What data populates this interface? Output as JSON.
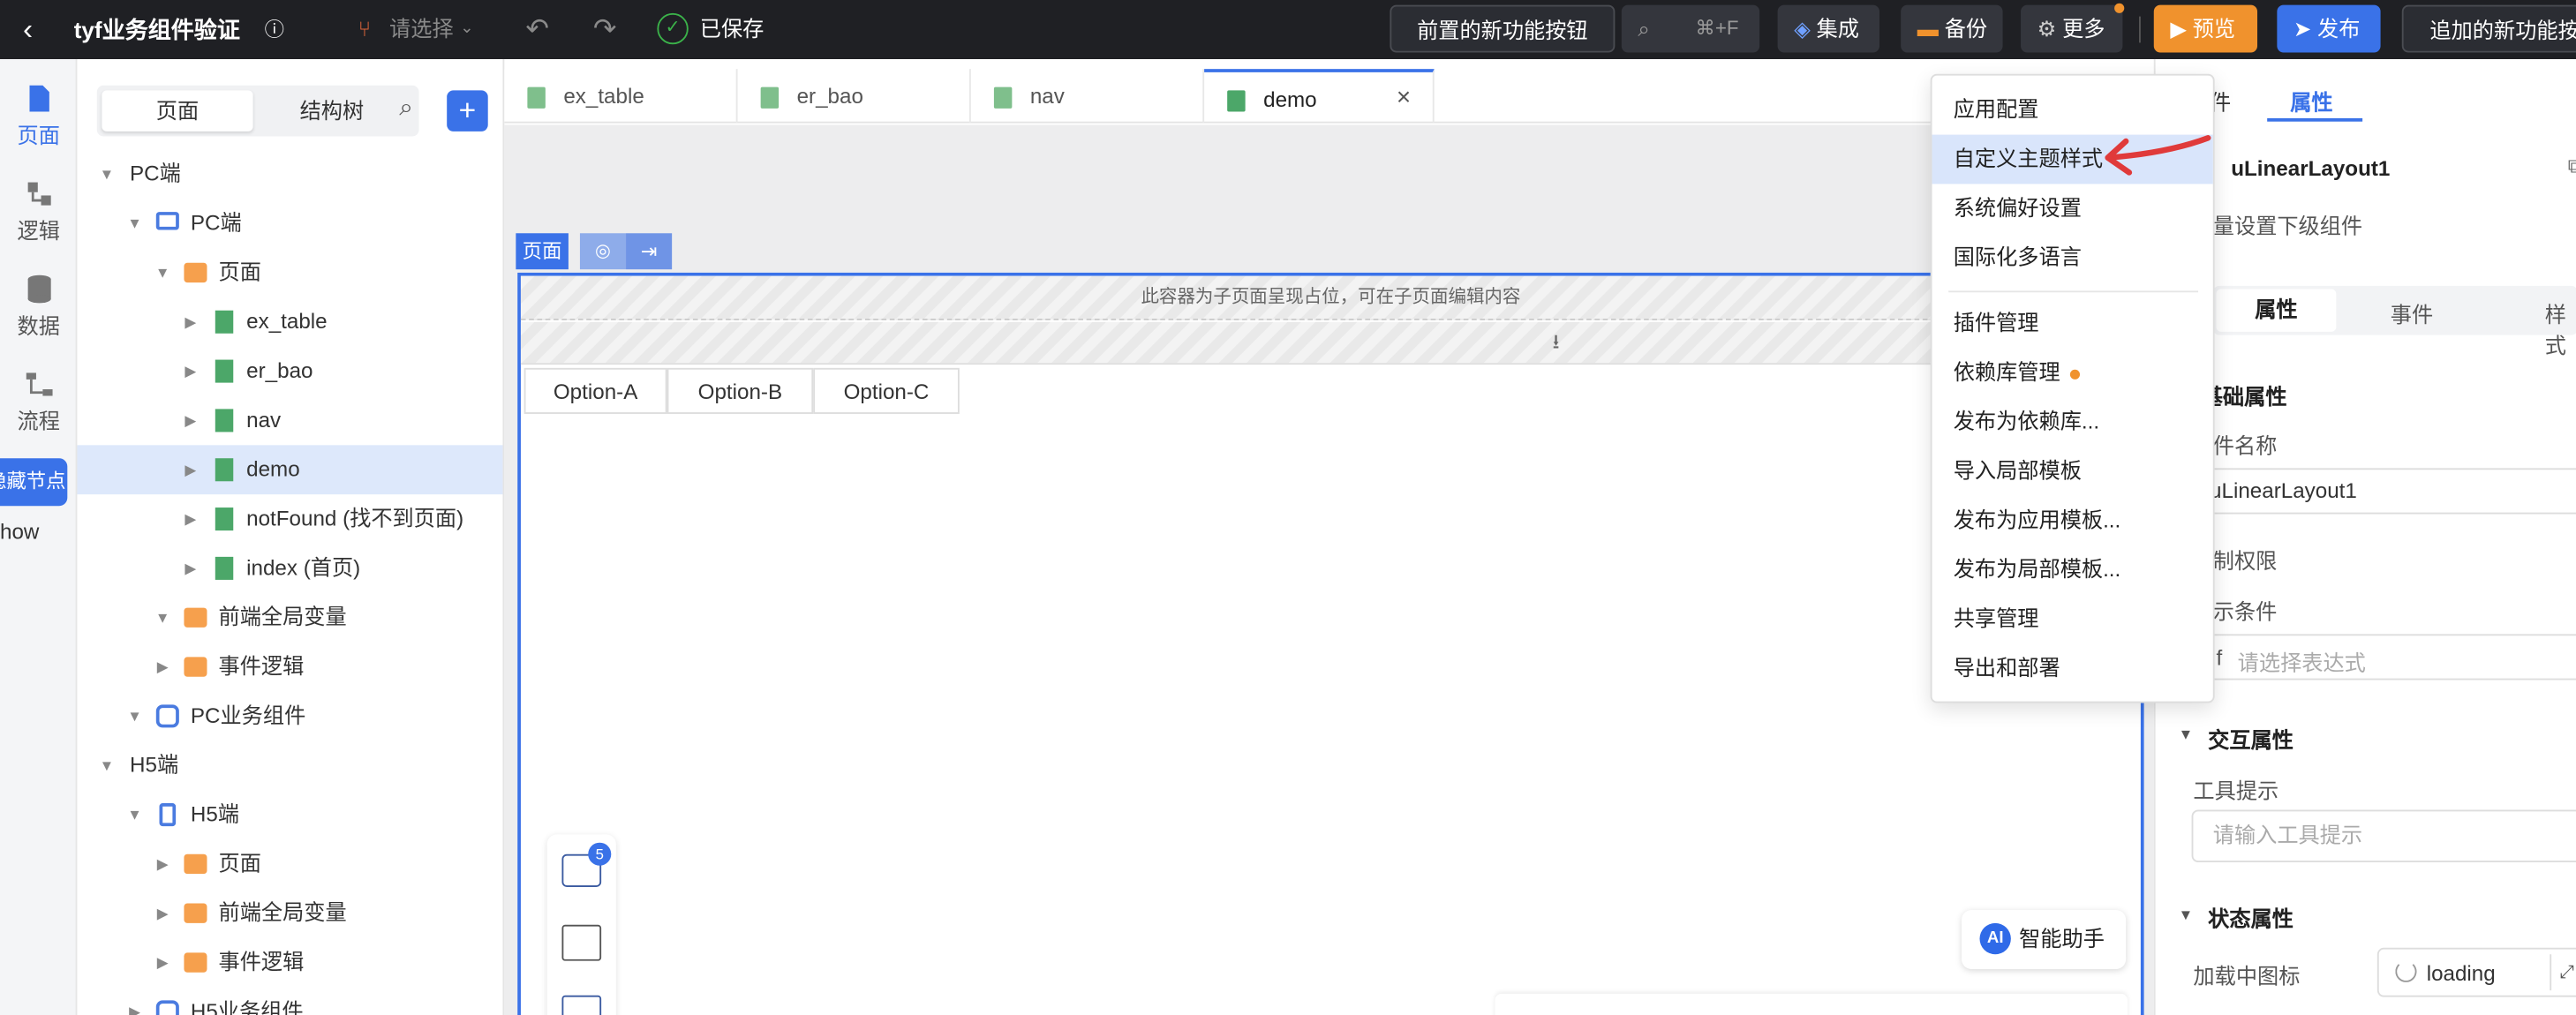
{
  "topbar": {
    "back_icon": "chevron-left-icon",
    "title": "tyf业务组件验证",
    "info_icon": "info-icon",
    "branch_placeholder": "请选择",
    "saved_label": "已保存",
    "feature_button": "前置的新功能按钮",
    "search_shortcut": "⌘+F",
    "integrate_label": "集成",
    "backup_label": "备份",
    "more_label": "更多",
    "preview_label": "预览",
    "publish_label": "发布",
    "extra_button": "追加的新功能按"
  },
  "rail": [
    {
      "label": "页面",
      "icon": "page-icon",
      "active": true
    },
    {
      "label": "逻辑",
      "icon": "logic-icon"
    },
    {
      "label": "数据",
      "icon": "database-icon"
    },
    {
      "label": "流程",
      "icon": "flow-icon"
    }
  ],
  "rail_hidden_badge": "隐藏节点",
  "rail_show_text": "how",
  "tree": {
    "segment": [
      "页面",
      "结构树"
    ],
    "rows": [
      {
        "label": "PC端",
        "indent": 0,
        "arrow": "▼",
        "icon": "none"
      },
      {
        "label": "PC端",
        "indent": 1,
        "arrow": "▼",
        "icon": "monitor"
      },
      {
        "label": "页面",
        "indent": 2,
        "arrow": "▼",
        "icon": "folder"
      },
      {
        "label": "ex_table",
        "indent": 3,
        "arrow": "▶",
        "icon": "file"
      },
      {
        "label": "er_bao",
        "indent": 3,
        "arrow": "▶",
        "icon": "file"
      },
      {
        "label": "nav",
        "indent": 3,
        "arrow": "▶",
        "icon": "file"
      },
      {
        "label": "demo",
        "indent": 3,
        "arrow": "▶",
        "icon": "file",
        "selected": true
      },
      {
        "label": "notFound (找不到页面)",
        "indent": 3,
        "arrow": "▶",
        "icon": "file"
      },
      {
        "label": "index (首页)",
        "indent": 3,
        "arrow": "▶",
        "icon": "file"
      },
      {
        "label": "前端全局变量",
        "indent": 2,
        "arrow": "▼",
        "icon": "folder"
      },
      {
        "label": "事件逻辑",
        "indent": 2,
        "arrow": "▶",
        "icon": "folder"
      },
      {
        "label": "PC业务组件",
        "indent": 1,
        "arrow": "▼",
        "icon": "puzzle"
      },
      {
        "label": "H5端",
        "indent": 0,
        "arrow": "▼",
        "icon": "none"
      },
      {
        "label": "H5端",
        "indent": 1,
        "arrow": "▼",
        "icon": "phone"
      },
      {
        "label": "页面",
        "indent": 2,
        "arrow": "▶",
        "icon": "folder"
      },
      {
        "label": "前端全局变量",
        "indent": 2,
        "arrow": "▶",
        "icon": "folder"
      },
      {
        "label": "事件逻辑",
        "indent": 2,
        "arrow": "▶",
        "icon": "folder"
      },
      {
        "label": "H5业务组件",
        "indent": 1,
        "arrow": "▶",
        "icon": "puzzle"
      }
    ]
  },
  "tabs": [
    {
      "label": "ex_table"
    },
    {
      "label": "er_bao"
    },
    {
      "label": "nav"
    },
    {
      "label": "demo",
      "active": true,
      "close": "×"
    }
  ],
  "canvas": {
    "page_tag": "页面",
    "placeholder_text": "此容器为子页面呈现占位，可在子页面编辑内容",
    "options": [
      "Option-A",
      "Option-B",
      "Option-C"
    ],
    "badge_count": "5",
    "ai_assistant": "智能助手"
  },
  "menu": {
    "items": [
      {
        "label": "应用配置"
      },
      {
        "label": "自定义主题样式",
        "highlight": true
      },
      {
        "label": "系统偏好设置"
      },
      {
        "label": "国际化多语言"
      },
      {
        "label": "插件管理"
      },
      {
        "label": "依赖库管理",
        "dot": true
      },
      {
        "label": "发布为依赖库..."
      },
      {
        "label": "导入局部模板"
      },
      {
        "label": "发布为应用模板..."
      },
      {
        "label": "发布为局部模板..."
      },
      {
        "label": "共享管理"
      },
      {
        "label": "导出和部署"
      }
    ]
  },
  "rpanel": {
    "top_tabs": [
      "件",
      "属性"
    ],
    "component_name": "uLinearLayout1",
    "batch_text": "量设置下级组件",
    "sub_tabs": [
      "属性",
      "事件",
      "样式"
    ],
    "base_section": "基础属性",
    "name_label": "件名称",
    "name_value": "uLinearLayout1",
    "perm_label": "制权限",
    "cond_label": "示条件",
    "if_label": "f",
    "expr_placeholder": "请选择表达式",
    "interact_section": "交互属性",
    "tooltip_label": "工具提示",
    "tooltip_placeholder": "请输入工具提示",
    "state_section": "状态属性",
    "loading_label": "加载中图标",
    "loading_value": "loading"
  },
  "colors": {
    "accent": "#3a72e8",
    "preview": "#f0922d",
    "publish": "#3a72e8",
    "highlight_arrow": "#e03a3a"
  }
}
